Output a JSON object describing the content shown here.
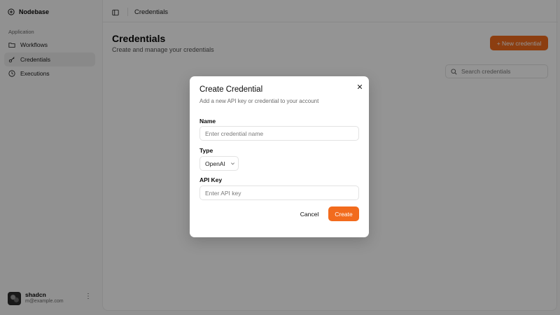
{
  "app": {
    "name": "Nodebase"
  },
  "sidebar": {
    "group_label": "Application",
    "items": [
      {
        "label": "Workflows",
        "icon": "folder-icon",
        "active": false
      },
      {
        "label": "Credentials",
        "icon": "key-icon",
        "active": true
      },
      {
        "label": "Executions",
        "icon": "clock-icon",
        "active": false
      }
    ],
    "user": {
      "name": "shadcn",
      "email": "m@example.com"
    }
  },
  "topbar": {
    "title": "Credentials"
  },
  "page": {
    "title": "Credentials",
    "subtitle": "Create and manage your credentials",
    "new_button": "+ New credential",
    "search_placeholder": "Search credentials"
  },
  "modal": {
    "title": "Create Credential",
    "description": "Add a new API key or credential to your account",
    "name_label": "Name",
    "name_placeholder": "Enter credential name",
    "type_label": "Type",
    "type_value": "OpenAI",
    "apikey_label": "API Key",
    "apikey_placeholder": "Enter API key",
    "cancel_label": "Cancel",
    "create_label": "Create"
  },
  "colors": {
    "accent": "#f26b1d",
    "overlay": "rgba(0,0,0,0.42)"
  }
}
